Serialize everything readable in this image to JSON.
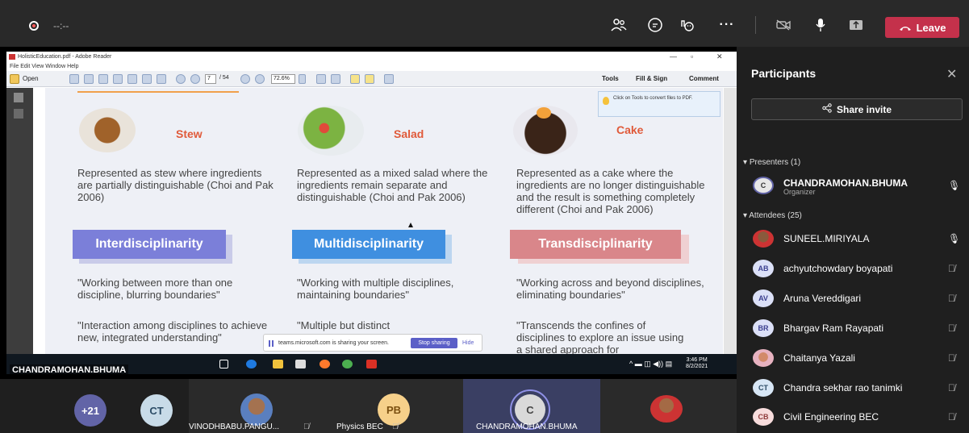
{
  "teams": {
    "timer": "--:--",
    "leave_label": "Leave",
    "icons": [
      "participants-icon",
      "chat-icon",
      "reactions-icon",
      "more-icon",
      "camera-off-icon",
      "mic-icon",
      "share-tray-icon"
    ]
  },
  "reader": {
    "title": "HolisticEducation.pdf - Adobe Reader",
    "menu": "File  Edit  View  Window  Help",
    "open_label": "Open",
    "page_current": "7",
    "page_total": "/ 54",
    "zoom": "72.6%",
    "tools_label": "Tools",
    "fill_sign_label": "Fill & Sign",
    "comment_label": "Comment",
    "tip": "Click on Tools to convert files to PDF."
  },
  "slide": {
    "columns": [
      {
        "food": "Stew",
        "desc": "Represented as stew where ingredients are partially distinguishable (Choi and Pak 2006)",
        "band": "Interdisciplinarity",
        "band_color": "#7b7fd9",
        "quote1": "\"Working between more than one discipline, blurring boundaries\"",
        "quote2": "\"Interaction among disciplines to achieve new, integrated understanding\""
      },
      {
        "food": "Salad",
        "desc": "Represented as a mixed salad where the ingredients remain separate and distinguishable (Choi and Pak 2006)",
        "band": "Multidisciplinarity",
        "band_color": "#3f8fe0",
        "quote1": "\"Working with multiple disciplines, maintaining boundaries\"",
        "quote2": "\"Multiple but distinct"
      },
      {
        "food": "Cake",
        "desc": "Represented as a cake where the ingredients are no longer distinguishable and the result is something completely different (Choi and Pak 2006)",
        "band": "Transdisciplinarity",
        "band_color": "#d9868a",
        "quote1": "\"Working across and beyond disciplines, eliminating boundaries\"",
        "quote2": "\"Transcends the confines of disciplines to explore an issue using a shared approach for"
      }
    ]
  },
  "share_banner": {
    "message": "teams.microsoft.com is sharing your screen.",
    "stop_label": "Stop sharing",
    "hide_label": "Hide"
  },
  "taskbar": {
    "time": "3:46 PM",
    "date": "8/2/2021"
  },
  "presenter_label": "CHANDRAMOHAN.BHUMA",
  "gallery": {
    "overflow": "+21",
    "tiles": [
      {
        "initials": "CT",
        "name": ""
      },
      {
        "initials": "",
        "name": "VINODHBABU.PANGU..."
      },
      {
        "initials": "PB",
        "name": "Physics BEC"
      },
      {
        "initials": "C",
        "name": "CHANDRAMOHAN.BHUMA"
      },
      {
        "initials": "",
        "name": ""
      }
    ]
  },
  "participants": {
    "title": "Participants",
    "share_invite": "Share invite",
    "presenters_header": "Presenters (1)",
    "attendees_header": "Attendees (25)",
    "presenters": [
      {
        "initials": "C",
        "name": "CHANDRAMOHAN.BHUMA",
        "role": "Organizer",
        "muted": false
      }
    ],
    "attendees": [
      {
        "initials": "",
        "name": "SUNEEL.MIRIYALA",
        "muted": false,
        "photo": true
      },
      {
        "initials": "AB",
        "name": "achyutchowdary boyapati",
        "muted": true
      },
      {
        "initials": "AV",
        "name": "Aruna Vereddigari",
        "muted": true
      },
      {
        "initials": "BR",
        "name": "Bhargav Ram Rayapati",
        "muted": true
      },
      {
        "initials": "",
        "name": "Chaitanya Yazali",
        "muted": true,
        "photo": true
      },
      {
        "initials": "CT",
        "name": "Chandra sekhar rao tanimki",
        "muted": true
      },
      {
        "initials": "CB",
        "name": "Civil Engineering BEC",
        "muted": true
      }
    ]
  }
}
